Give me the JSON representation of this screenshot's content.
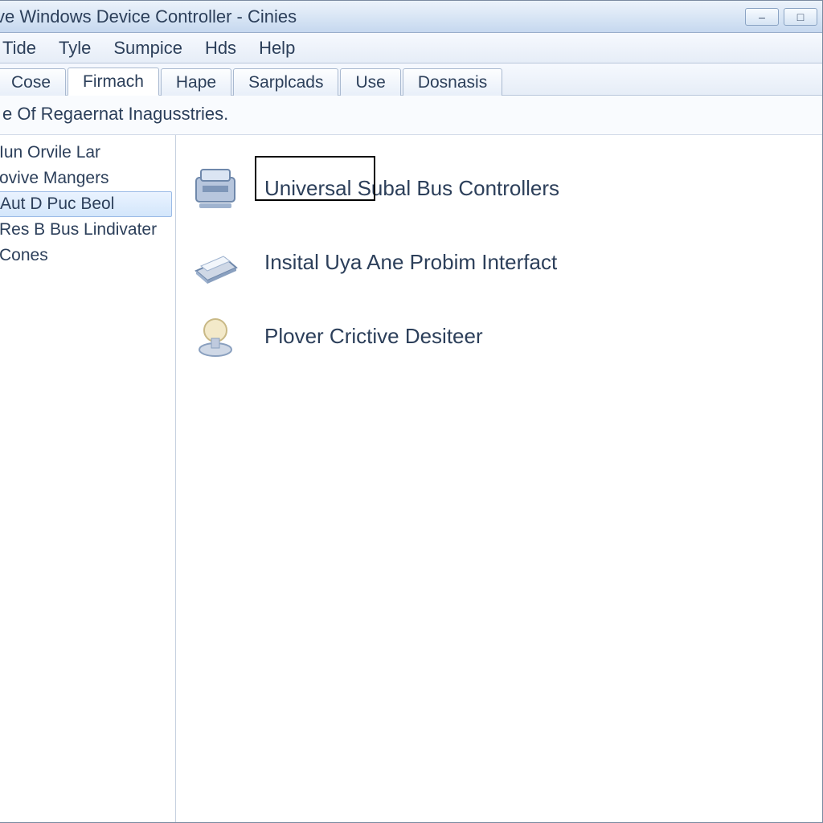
{
  "window": {
    "title": "ve Windows Device Controller - Cinies"
  },
  "menu": {
    "items": [
      "Tide",
      "Tyle",
      "Sumpice",
      "Hds",
      "Help"
    ]
  },
  "tabs": {
    "items": [
      "Cose",
      "Firmach",
      "Hape",
      "Sarplcads",
      "Use",
      "Dosnasis"
    ],
    "active_index": 1
  },
  "subheader": "e Of Regaernat Inagusstries.",
  "sidebar": {
    "items": [
      "Iun Orvile Lar",
      "ovive Mangers",
      "Aut D Puc Beol",
      "Res B Bus Lindivater",
      "Cones"
    ],
    "selected_index": 2
  },
  "content": {
    "entries": [
      {
        "label": "Universal Subal Bus Controllers",
        "icon": "device-hub-icon"
      },
      {
        "label": "Insital Uya Ane Probim Interfact",
        "icon": "scanner-icon"
      },
      {
        "label": "Plover Crictive Desiteer",
        "icon": "bulb-icon"
      }
    ]
  },
  "window_controls": {
    "minimize": "–",
    "maximize": "□",
    "close": "×"
  }
}
